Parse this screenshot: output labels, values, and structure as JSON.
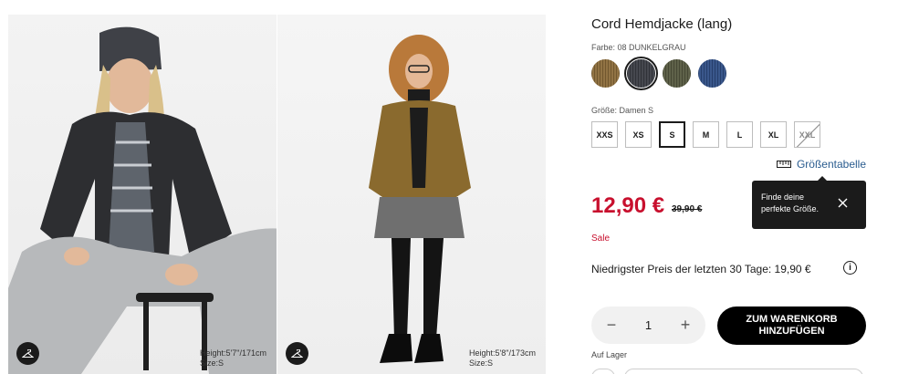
{
  "product": {
    "title": "Cord Hemdjacke (lang)",
    "color_label": "Farbe: 08 DUNKELGRAU",
    "size_label": "Größe: Damen S",
    "price": "12,90 €",
    "old_price": "39,90 €",
    "sale": "Sale",
    "lowest_price": "Niedrigster Preis der letzten 30 Tage: 19,90 €",
    "size_chart": "Größentabelle",
    "tooltip": "Finde deine\nperfekte Größe.",
    "quantity": "1",
    "add_to_cart": "ZUM WARENKORB\nHINZUFÜGEN",
    "stock": "Auf Lager"
  },
  "swatches": [
    {
      "name": "brown",
      "color": "#8a6a38",
      "selected": false
    },
    {
      "name": "dark-gray",
      "color": "#3a3d44",
      "selected": true
    },
    {
      "name": "olive",
      "color": "#55583f",
      "selected": false
    },
    {
      "name": "blue",
      "color": "#2e4d84",
      "selected": false
    }
  ],
  "sizes": [
    {
      "label": "XXS",
      "selected": false,
      "soldout": false
    },
    {
      "label": "XS",
      "selected": false,
      "soldout": false
    },
    {
      "label": "S",
      "selected": true,
      "soldout": false
    },
    {
      "label": "M",
      "selected": false,
      "soldout": false
    },
    {
      "label": "L",
      "selected": false,
      "soldout": false
    },
    {
      "label": "XL",
      "selected": false,
      "soldout": false
    },
    {
      "label": "XXL",
      "selected": false,
      "soldout": true
    }
  ],
  "images": [
    {
      "height": "Height:5'7\"/171cm",
      "size": "Size:S",
      "icon": "hanger-icon"
    },
    {
      "height": "Height:5'8\"/173cm",
      "size": "Size:S",
      "icon": "hanger-icon"
    }
  ],
  "colors": {
    "sale_red": "#c8102e",
    "link_blue": "#2a5c8f",
    "dark": "#1b1b1b"
  }
}
